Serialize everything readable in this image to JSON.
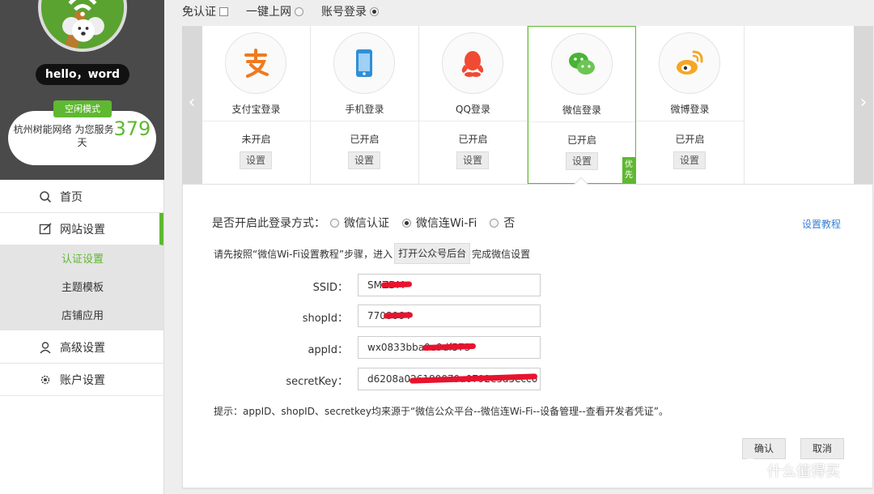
{
  "top_options": [
    {
      "label": "免认证",
      "control": "checkbox",
      "checked": false
    },
    {
      "label": "一键上网",
      "control": "radio",
      "checked": false
    },
    {
      "label": "账号登录",
      "control": "radio",
      "checked": true
    }
  ],
  "profile": {
    "greeting": "hello，word",
    "mode_badge": "空闲模式",
    "service_prefix": "杭州树能网络 为您服务",
    "service_days": "379",
    "service_suffix": "天"
  },
  "sidebar": {
    "items": [
      {
        "label": "首页",
        "icon": "search-icon"
      },
      {
        "label": "网站设置",
        "icon": "edit-icon",
        "active": true,
        "children": [
          {
            "label": "认证设置",
            "active": true
          },
          {
            "label": "主题模板"
          },
          {
            "label": "店铺应用"
          }
        ]
      },
      {
        "label": "高级设置",
        "icon": "user-icon"
      },
      {
        "label": "账户设置",
        "icon": "gear-icon"
      }
    ]
  },
  "methods": [
    {
      "name": "支付宝登录",
      "status": "未开启",
      "button": "设置",
      "icon": "alipay-icon"
    },
    {
      "name": "手机登录",
      "status": "已开启",
      "button": "设置",
      "icon": "phone-icon"
    },
    {
      "name": "QQ登录",
      "status": "已开启",
      "button": "设置",
      "icon": "qq-icon"
    },
    {
      "name": "微信登录",
      "status": "已开启",
      "button": "设置",
      "icon": "wechat-icon",
      "selected": true,
      "badge": "优先"
    },
    {
      "name": "微博登录",
      "status": "已开启",
      "button": "设置",
      "icon": "weibo-icon"
    }
  ],
  "panel": {
    "question": "是否开启此登录方式：",
    "options": [
      {
        "label": "微信认证",
        "selected": false
      },
      {
        "label": "微信连Wi-Fi",
        "selected": true
      },
      {
        "label": "否",
        "selected": false
      }
    ],
    "tutorial_link": "设置教程",
    "instruction_before": "请先按照“微信Wi-Fi设置教程”步骤，进入",
    "open_backend_button": "打开公众号后台",
    "instruction_after": "完成微信设置",
    "fields": [
      {
        "label": "SSID：",
        "value": "SMZDM"
      },
      {
        "label": "shopId：",
        "value": "7708064"
      },
      {
        "label": "appId：",
        "value": "wx0833bba0e9df573"
      },
      {
        "label": "secretKey：",
        "value": "d6208a026180079a0792e5a5ecc0"
      }
    ],
    "hint": "提示：appID、shopID、secretkey均来源于“微信公众平台--微信连Wi-Fi--设备管理--查看开发者凭证”。",
    "confirm_button": "确认",
    "cancel_button": "取消"
  },
  "watermark": {
    "text": "什么值得买",
    "icon_glyph": "值"
  },
  "colors": {
    "accent": "#5fb831",
    "link": "#3a7fd0",
    "sidebar_dark": "#4a4a4a",
    "redaction": "#e8132e"
  }
}
